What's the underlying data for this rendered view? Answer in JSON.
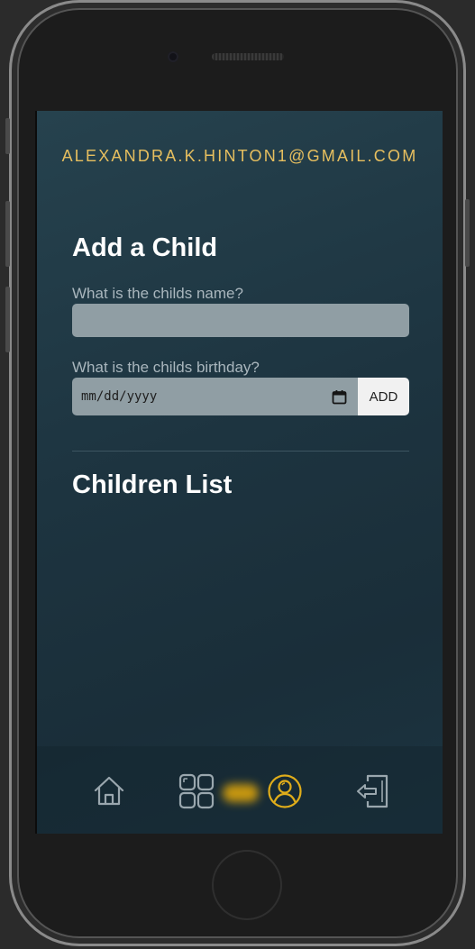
{
  "header": {
    "email": "ALEXANDRA.K.HINTON1@GMAIL.COM"
  },
  "add_child": {
    "title": "Add a Child",
    "name_label": "What is the childs name?",
    "name_value": "",
    "birthday_label": "What is the childs birthday?",
    "birthday_placeholder": "mm/dd/yyyy",
    "add_button": "ADD"
  },
  "children_list": {
    "title": "Children List",
    "items": []
  },
  "nav": {
    "items": [
      {
        "icon": "home-icon",
        "active": false
      },
      {
        "icon": "dashboard-icon",
        "active": false
      },
      {
        "icon": "profile-icon",
        "active": true
      },
      {
        "icon": "logout-icon",
        "active": false
      }
    ]
  },
  "colors": {
    "accent": "#e7bf5f",
    "active_icon": "#e0ad1a",
    "icon": "#9aa7ae",
    "input_bg": "#909ea4"
  }
}
